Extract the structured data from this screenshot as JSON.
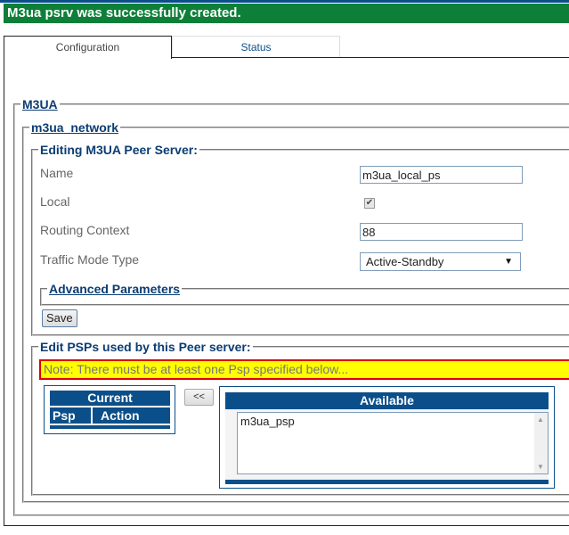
{
  "banner": {
    "message": "M3ua psrv was successfully created.",
    "color": "#0e7f38"
  },
  "tabs": [
    {
      "label": "Configuration",
      "active": true
    },
    {
      "label": "Status",
      "active": false
    }
  ],
  "sections": {
    "m3ua": "M3UA",
    "network": "m3ua_network",
    "editing": "Editing M3UA Peer Server:",
    "advanced": "Advanced Parameters",
    "psps": "Edit PSPs used by this Peer server:"
  },
  "form": {
    "name": {
      "label": "Name",
      "value": "m3ua_local_ps"
    },
    "local": {
      "label": "Local",
      "checked": true,
      "glyph": "✔"
    },
    "routing_context": {
      "label": "Routing Context",
      "value": "88"
    },
    "traffic_mode": {
      "label": "Traffic Mode Type",
      "value": "Active-Standby",
      "arrow": "▼"
    },
    "save_label": "Save"
  },
  "psp": {
    "note": "Note: There must be at least one Psp specified below...",
    "current": {
      "title": "Current",
      "columns": [
        "Psp",
        "Action"
      ],
      "rows": []
    },
    "move_label": "<<",
    "available": {
      "title": "Available",
      "items": [
        "m3ua_psp"
      ]
    },
    "scroll_up": "▲",
    "scroll_down": "▼"
  },
  "colors": {
    "header_blue": "#0b4f8a",
    "note_bg": "#ffff00",
    "note_border": "#e00000",
    "legend": "#0b3d73"
  }
}
